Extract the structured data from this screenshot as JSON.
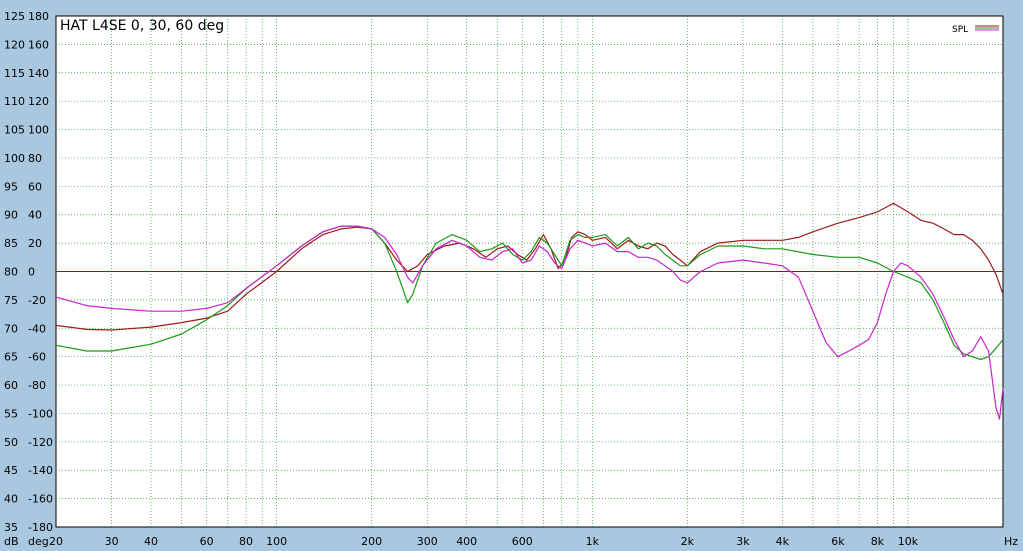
{
  "chart_data": {
    "type": "line",
    "title": "HAT L4SE 0, 30, 60 deg",
    "legend_label": "SPL",
    "legend_position": "top-right",
    "x_unit_label": "Hz",
    "y_unit_label_db": "dB",
    "y_unit_label_deg": "deg",
    "x_scale": "log",
    "xlim": [
      20,
      20000
    ],
    "ylim": [
      35,
      125
    ],
    "grid": true,
    "x_ticks": [
      {
        "value": 20,
        "label": "20"
      },
      {
        "value": 30,
        "label": "30"
      },
      {
        "value": 40,
        "label": "40"
      },
      {
        "value": 60,
        "label": "60"
      },
      {
        "value": 80,
        "label": "80"
      },
      {
        "value": 100,
        "label": "100"
      },
      {
        "value": 200,
        "label": "200"
      },
      {
        "value": 300,
        "label": "300"
      },
      {
        "value": 400,
        "label": "400"
      },
      {
        "value": 600,
        "label": "600"
      },
      {
        "value": 1000,
        "label": "1k"
      },
      {
        "value": 2000,
        "label": "2k"
      },
      {
        "value": 3000,
        "label": "3k"
      },
      {
        "value": 4000,
        "label": "4k"
      },
      {
        "value": 6000,
        "label": "6k"
      },
      {
        "value": 8000,
        "label": "8k"
      },
      {
        "value": 10000,
        "label": "10k"
      }
    ],
    "y_ticks_db": [
      125,
      120,
      115,
      110,
      105,
      100,
      95,
      90,
      85,
      80,
      75,
      70,
      65,
      60,
      55,
      50,
      45,
      40,
      35
    ],
    "y_ticks_deg": [
      180,
      160,
      140,
      120,
      100,
      80,
      60,
      40,
      20,
      0,
      -20,
      -40,
      -60,
      -80,
      -100,
      -120,
      -140,
      -160,
      -180
    ],
    "reference_line": {
      "y": 80,
      "color": "#c00000"
    },
    "series": [
      {
        "color": "#9b1a1a",
        "points": [
          [
            20,
            70.5
          ],
          [
            25,
            69.8
          ],
          [
            30,
            69.7
          ],
          [
            40,
            70.2
          ],
          [
            50,
            71
          ],
          [
            60,
            71.8
          ],
          [
            70,
            73
          ],
          [
            80,
            76
          ],
          [
            100,
            80
          ],
          [
            120,
            84
          ],
          [
            140,
            86.5
          ],
          [
            160,
            87.5
          ],
          [
            180,
            87.8
          ],
          [
            200,
            87.5
          ],
          [
            220,
            85
          ],
          [
            240,
            82
          ],
          [
            260,
            80
          ],
          [
            280,
            81
          ],
          [
            300,
            83
          ],
          [
            340,
            84.5
          ],
          [
            380,
            85
          ],
          [
            420,
            84
          ],
          [
            460,
            82.5
          ],
          [
            500,
            84
          ],
          [
            540,
            84.5
          ],
          [
            580,
            83
          ],
          [
            620,
            82
          ],
          [
            660,
            84
          ],
          [
            700,
            86.5
          ],
          [
            740,
            84
          ],
          [
            780,
            80.5
          ],
          [
            820,
            82
          ],
          [
            860,
            86
          ],
          [
            900,
            87
          ],
          [
            950,
            86.5
          ],
          [
            1000,
            85.5
          ],
          [
            1100,
            86
          ],
          [
            1200,
            84
          ],
          [
            1300,
            85.5
          ],
          [
            1400,
            84.5
          ],
          [
            1500,
            84
          ],
          [
            1600,
            85
          ],
          [
            1700,
            84.5
          ],
          [
            1800,
            83
          ],
          [
            1900,
            82
          ],
          [
            2000,
            81
          ],
          [
            2200,
            83.5
          ],
          [
            2500,
            85
          ],
          [
            3000,
            85.5
          ],
          [
            3500,
            85.5
          ],
          [
            4000,
            85.5
          ],
          [
            4500,
            86
          ],
          [
            5000,
            87
          ],
          [
            6000,
            88.5
          ],
          [
            7000,
            89.5
          ],
          [
            8000,
            90.5
          ],
          [
            9000,
            92
          ],
          [
            10000,
            90.5
          ],
          [
            11000,
            89
          ],
          [
            12000,
            88.5
          ],
          [
            13000,
            87.5
          ],
          [
            14000,
            86.5
          ],
          [
            15000,
            86.5
          ],
          [
            16000,
            85.5
          ],
          [
            17000,
            84
          ],
          [
            18000,
            82
          ],
          [
            19000,
            79.5
          ],
          [
            20000,
            76
          ]
        ]
      },
      {
        "color": "#1a9a1a",
        "points": [
          [
            20,
            67
          ],
          [
            25,
            66
          ],
          [
            30,
            66
          ],
          [
            40,
            67.2
          ],
          [
            50,
            69
          ],
          [
            60,
            71.5
          ],
          [
            70,
            74
          ],
          [
            80,
            77
          ],
          [
            100,
            81
          ],
          [
            120,
            84.5
          ],
          [
            140,
            87
          ],
          [
            160,
            88
          ],
          [
            180,
            88
          ],
          [
            200,
            87.5
          ],
          [
            220,
            85
          ],
          [
            240,
            80
          ],
          [
            260,
            74.5
          ],
          [
            270,
            76
          ],
          [
            290,
            81
          ],
          [
            320,
            85
          ],
          [
            360,
            86.5
          ],
          [
            400,
            85.5
          ],
          [
            440,
            83.5
          ],
          [
            480,
            84
          ],
          [
            520,
            85
          ],
          [
            560,
            83
          ],
          [
            600,
            82
          ],
          [
            640,
            83.5
          ],
          [
            680,
            86
          ],
          [
            720,
            85
          ],
          [
            760,
            83
          ],
          [
            800,
            81
          ],
          [
            850,
            85.5
          ],
          [
            900,
            86.5
          ],
          [
            950,
            86
          ],
          [
            1000,
            86
          ],
          [
            1100,
            86.5
          ],
          [
            1200,
            84.5
          ],
          [
            1300,
            86
          ],
          [
            1400,
            84
          ],
          [
            1500,
            85
          ],
          [
            1600,
            84.5
          ],
          [
            1700,
            83
          ],
          [
            1800,
            82
          ],
          [
            1900,
            81
          ],
          [
            2000,
            81
          ],
          [
            2200,
            83
          ],
          [
            2500,
            84.5
          ],
          [
            3000,
            84.5
          ],
          [
            3500,
            84
          ],
          [
            4000,
            84
          ],
          [
            5000,
            83
          ],
          [
            6000,
            82.5
          ],
          [
            7000,
            82.5
          ],
          [
            8000,
            81.5
          ],
          [
            9000,
            80
          ],
          [
            10000,
            79
          ],
          [
            11000,
            78
          ],
          [
            12000,
            75
          ],
          [
            13000,
            71
          ],
          [
            14000,
            67
          ],
          [
            15000,
            65.5
          ],
          [
            16000,
            65
          ],
          [
            17000,
            64.5
          ],
          [
            18000,
            65
          ],
          [
            19000,
            66.5
          ],
          [
            20000,
            68
          ]
        ]
      },
      {
        "color": "#cc22cc",
        "points": [
          [
            20,
            75.5
          ],
          [
            25,
            74
          ],
          [
            30,
            73.5
          ],
          [
            40,
            73
          ],
          [
            50,
            73
          ],
          [
            60,
            73.5
          ],
          [
            70,
            74.5
          ],
          [
            80,
            77
          ],
          [
            100,
            81
          ],
          [
            120,
            84.5
          ],
          [
            140,
            87
          ],
          [
            160,
            88
          ],
          [
            180,
            88
          ],
          [
            200,
            87.5
          ],
          [
            220,
            86
          ],
          [
            240,
            83
          ],
          [
            260,
            79
          ],
          [
            270,
            78
          ],
          [
            290,
            81
          ],
          [
            320,
            84
          ],
          [
            360,
            85.5
          ],
          [
            400,
            84.5
          ],
          [
            440,
            82.5
          ],
          [
            480,
            82
          ],
          [
            520,
            83.5
          ],
          [
            560,
            84
          ],
          [
            600,
            81.5
          ],
          [
            640,
            82
          ],
          [
            680,
            84.5
          ],
          [
            720,
            83.5
          ],
          [
            760,
            81.5
          ],
          [
            800,
            80.5
          ],
          [
            850,
            84
          ],
          [
            900,
            85.5
          ],
          [
            950,
            85
          ],
          [
            1000,
            84.5
          ],
          [
            1100,
            85
          ],
          [
            1200,
            83.5
          ],
          [
            1300,
            83.5
          ],
          [
            1400,
            82.5
          ],
          [
            1500,
            82.5
          ],
          [
            1600,
            82
          ],
          [
            1700,
            81
          ],
          [
            1800,
            80
          ],
          [
            1900,
            78.5
          ],
          [
            2000,
            78
          ],
          [
            2200,
            80
          ],
          [
            2500,
            81.5
          ],
          [
            3000,
            82
          ],
          [
            3500,
            81.5
          ],
          [
            4000,
            81
          ],
          [
            4500,
            79
          ],
          [
            5000,
            73
          ],
          [
            5500,
            67.5
          ],
          [
            6000,
            65
          ],
          [
            6500,
            66
          ],
          [
            7000,
            67
          ],
          [
            7500,
            68
          ],
          [
            8000,
            71
          ],
          [
            8500,
            76
          ],
          [
            9000,
            80
          ],
          [
            9500,
            81.5
          ],
          [
            10000,
            81
          ],
          [
            11000,
            79
          ],
          [
            12000,
            76
          ],
          [
            13000,
            72
          ],
          [
            14000,
            68
          ],
          [
            15000,
            65
          ],
          [
            16000,
            66
          ],
          [
            17000,
            68.5
          ],
          [
            18000,
            66
          ],
          [
            19000,
            56
          ],
          [
            19500,
            54
          ],
          [
            20000,
            59.5
          ]
        ]
      }
    ]
  }
}
